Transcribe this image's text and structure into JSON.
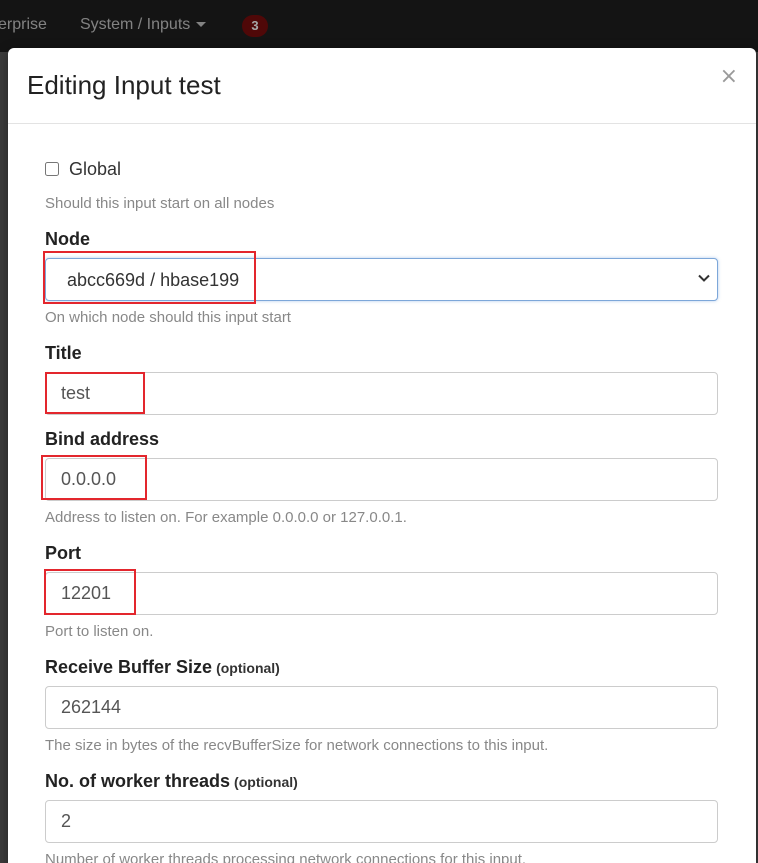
{
  "navbar": {
    "enterprise_label": "erprise",
    "system_label": "System / Inputs",
    "notification_count": "3"
  },
  "modal": {
    "title": "Editing Input test",
    "close_symbol": "×"
  },
  "form": {
    "global": {
      "label": "Global",
      "checked": false,
      "help": "Should this input start on all nodes"
    },
    "node": {
      "label": "Node",
      "value": "abcc669d / hbase199",
      "help": "On which node should this input start"
    },
    "title": {
      "label": "Title",
      "value": "test"
    },
    "bind_address": {
      "label": "Bind address",
      "value": "0.0.0.0",
      "help": "Address to listen on. For example 0.0.0.0 or 127.0.0.1."
    },
    "port": {
      "label": "Port",
      "value": "12201",
      "help": "Port to listen on."
    },
    "recv_buffer": {
      "label": "Receive Buffer Size",
      "optional": "(optional)",
      "value": "262144",
      "help": "The size in bytes of the recvBufferSize for network connections to this input."
    },
    "worker_threads": {
      "label": "No. of worker threads",
      "optional": "(optional)",
      "value": "2",
      "help": "Number of worker threads processing network connections for this input."
    }
  },
  "colors": {
    "highlight": "#e3262d",
    "navbar_bg": "#1f1f1f",
    "badge_bg": "#7a0d0d"
  }
}
